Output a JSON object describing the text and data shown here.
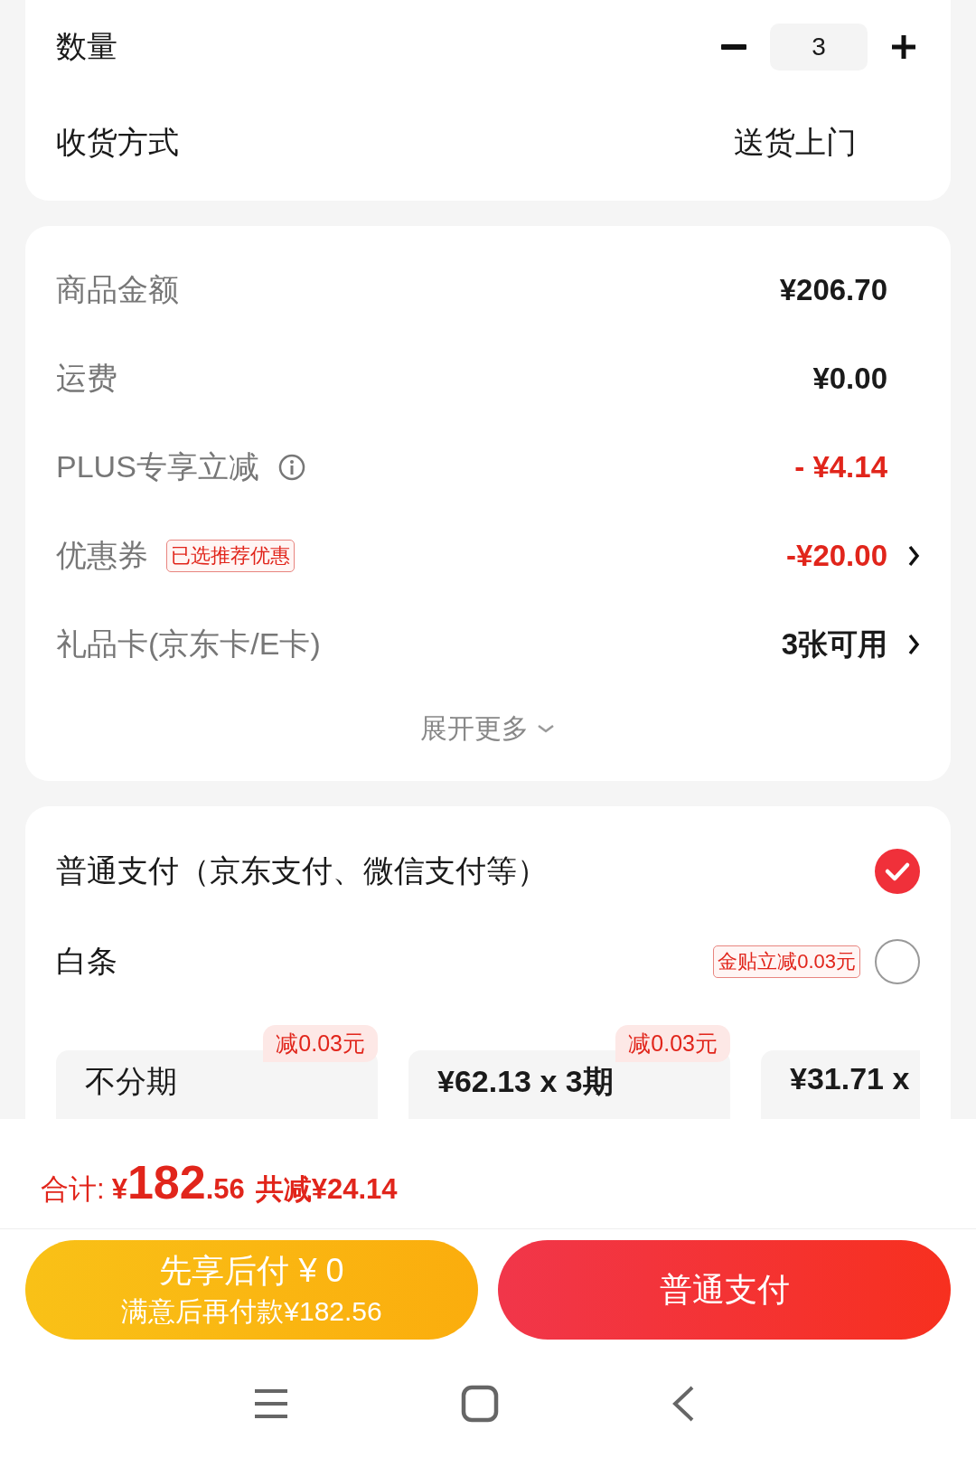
{
  "quantity": {
    "label": "数量",
    "value": "3"
  },
  "delivery": {
    "label": "收货方式",
    "value": "送货上门"
  },
  "summary": {
    "rows": [
      {
        "label": "商品金额",
        "value": "¥206.70",
        "highlight": false,
        "info": false,
        "arrow": false
      },
      {
        "label": "运费",
        "value": "¥0.00",
        "highlight": false,
        "info": false,
        "arrow": false
      },
      {
        "label": "PLUS专享立减",
        "value": "- ¥4.14",
        "highlight": true,
        "info": true,
        "arrow": false
      },
      {
        "label": "优惠券",
        "tag": "已选推荐优惠",
        "value": "-¥20.00",
        "highlight": true,
        "info": false,
        "arrow": true
      },
      {
        "label": "礼品卡(京东卡/E卡)",
        "value": "3张可用",
        "highlight": false,
        "info": false,
        "arrow": true
      }
    ],
    "expand": {
      "label": "展开更多",
      "expanded": false
    }
  },
  "payment": {
    "options": [
      {
        "label": "普通支付（京东支付、微信支付等）",
        "selected": true
      },
      {
        "label": "白条",
        "tag": "金贴立减0.03元",
        "selected": false
      }
    ],
    "installments": [
      {
        "label": "不分期",
        "badge": "减0.03元"
      },
      {
        "label": "¥62.13 x 3期",
        "badge": "减0.03元"
      },
      {
        "label": "¥31.71 x"
      }
    ]
  },
  "total": {
    "label": "合计:",
    "currency": "¥",
    "integer": "182",
    "decimal": ".56",
    "saving": "共减¥24.14"
  },
  "buttons": [
    {
      "kind": "later",
      "title": "先享后付 ¥ 0",
      "subtitle": "满意后再付款¥182.56"
    },
    {
      "kind": "pay",
      "title": "普通支付"
    }
  ]
}
